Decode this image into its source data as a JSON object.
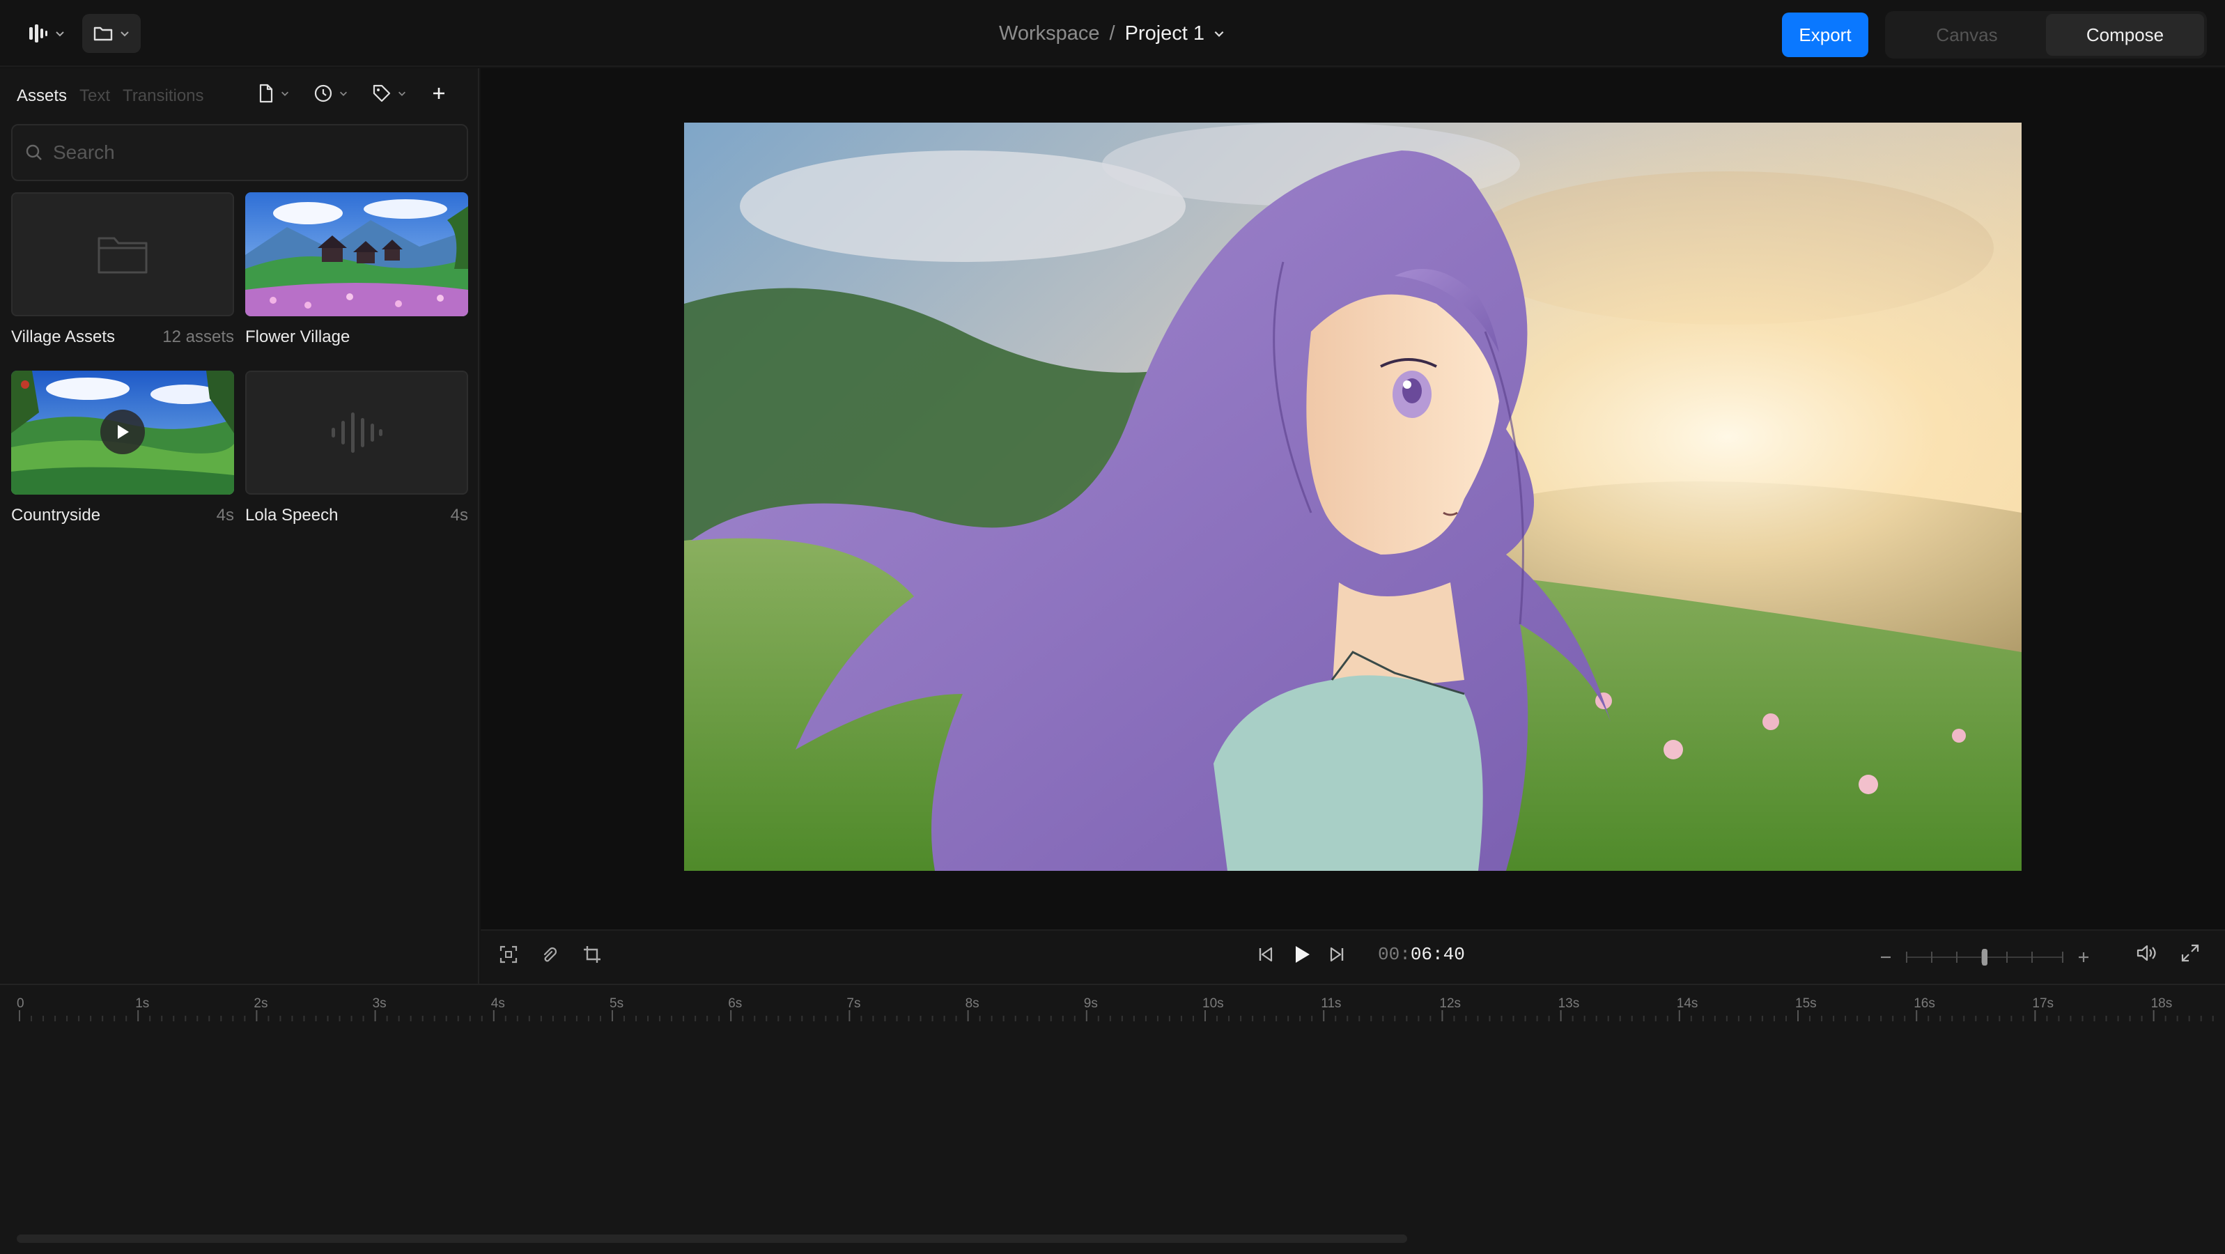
{
  "topbar": {
    "logo_icon": "waveform-logo-icon",
    "folder_icon": "folder-icon",
    "breadcrumb": {
      "workspace": "Workspace",
      "separator": "/",
      "project": "Project 1"
    },
    "export_label": "Export",
    "modes": [
      {
        "label": "Canvas",
        "active": false
      },
      {
        "label": "Compose",
        "active": true
      }
    ]
  },
  "left_panel": {
    "tabs": [
      {
        "label": "Assets",
        "active": true
      },
      {
        "label": "Text",
        "active": false
      },
      {
        "label": "Transitions",
        "active": false
      }
    ],
    "tool_icons": [
      "file-icon",
      "clock-icon",
      "tag-icon",
      "plus-icon"
    ],
    "search": {
      "placeholder": "Search",
      "value": ""
    },
    "assets": [
      {
        "name": "Village Assets",
        "info": "12 assets",
        "kind": "folder"
      },
      {
        "name": "Flower Village",
        "info": "",
        "kind": "image"
      },
      {
        "name": "Countryside",
        "info": "4s",
        "kind": "video"
      },
      {
        "name": "Lola Speech",
        "info": "4s",
        "kind": "audio"
      }
    ]
  },
  "player": {
    "left_icons": [
      "fit-screen-icon",
      "sticker-icon",
      "crop-icon"
    ],
    "timecode_prefix": "00:",
    "timecode_main": "06:40",
    "zoom_level": 0.5,
    "right_icons": [
      "zoom-out-icon",
      "zoom-in-icon",
      "volume-icon",
      "fullscreen-icon"
    ]
  },
  "timeline": {
    "ruler_labels": [
      "0",
      "1s",
      "2s",
      "3s",
      "4s",
      "5s",
      "6s",
      "7s",
      "8s",
      "9s",
      "10s",
      "11s",
      "12s",
      "13s",
      "14s",
      "15s",
      "16s",
      "17s",
      "18s"
    ]
  },
  "colors": {
    "accent": "#0a78ff",
    "background": "#141414",
    "panel": "#161616"
  }
}
